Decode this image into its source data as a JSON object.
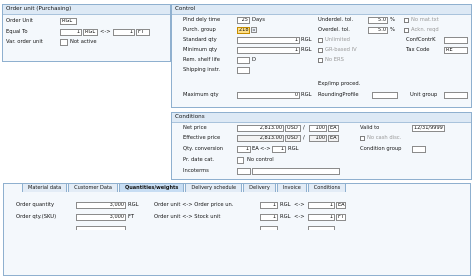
{
  "order_unit_panel": {
    "title": "Order unit (Purchasing)",
    "order_unit_label": "Order Unit",
    "order_unit_value": "RGL",
    "equal_to_label": "Equal To",
    "equal_qty": "1",
    "equal_unit": "RGL",
    "arrow": "<->",
    "equal_qty2": "1",
    "equal_unit2": "FT",
    "var_order_unit_label": "Var. order unit",
    "not_active": "Not active"
  },
  "control": {
    "title": "Control",
    "pind_label": "Plnd dely time",
    "pind_value": "25",
    "pind_unit": "Days",
    "purch_group_label": "Purch. group",
    "purch_group_value": "218",
    "standard_qty_label": "Standard qty",
    "standard_qty_value": "1",
    "standard_qty_unit": "RGL",
    "minimum_qty_label": "Minimum qty",
    "minimum_qty_value": "1",
    "minimum_qty_unit": "RGL",
    "rem_shelf_label": "Rem. shelf life",
    "rem_shelf_unit": "D",
    "shipping_instr_label": "Shipping instr.",
    "maximum_qty_label": "Maximum qty",
    "maximum_qty_value": "0",
    "maximum_qty_unit": "RGL",
    "underdel_label": "Underdel. tol.",
    "underdel_value": "5.0",
    "underdel_pct": "%",
    "overdel_label": "Overdel. tol.",
    "overdel_value": "5.0",
    "overdel_pct": "%",
    "unlimited": "Unlimited",
    "gr_based_iv": "GR-based IV",
    "no_ers": "No ERS",
    "no_mat_txt": "No mat.txt",
    "ackn_reqd": "Ackn. reqd",
    "conf_ctrl_label": "ConfContrK",
    "tax_code_label": "Tax Code",
    "tax_code_value": "RE",
    "exp_imp_label": "Exp/imp proced.",
    "rounding_label": "RoundingProfile",
    "unit_group_label": "Unit group"
  },
  "conditions": {
    "title": "Conditions",
    "net_price_label": "Net price",
    "net_price_value": "2,813.00",
    "net_price_curr": "USD",
    "net_per": "/",
    "net_price_per": "100",
    "net_price_unit": "EA",
    "valid_to_label": "Valid to",
    "valid_to_value": "12/31/9999",
    "effective_price_label": "Effective price",
    "effective_price_value": "2,813.00",
    "effective_price_curr": "USD",
    "eff_per": "/",
    "effective_price_per": "100",
    "effective_price_unit": "EA",
    "no_cash_disc": "No cash disc.",
    "qty_conversion_label": "Qty. conversion",
    "qty_conv_1": "1",
    "qty_conv_unit1": "EA",
    "qty_conv_arrow": "<->",
    "qty_conv_2": "1",
    "qty_conv_unit2": "RGL",
    "condition_group_label": "Condition group",
    "pr_date_cat_label": "Pr. date cat.",
    "no_control": "No control",
    "incoterms_label": "Incoterms"
  },
  "tabs": {
    "items": [
      "Material data",
      "Customer Data",
      "Quantities/weights",
      "Delivery schedule",
      "Delivery",
      "Invoice",
      "Conditions"
    ],
    "active_index": 2
  },
  "quantities": {
    "order_quantity_label": "Order quantity",
    "order_quantity_value": "3,000",
    "order_quantity_unit": "RGL",
    "order_qty_sku_label": "Order qty.(SKU)",
    "order_qty_sku_value": "3,000",
    "order_qty_sku_unit": "FT",
    "conv1_label": "Order unit <-> Order price un.",
    "conv1_a": "1",
    "conv1_a_unit": "RGL",
    "conv1_arrow": "<->",
    "conv1_b": "1",
    "conv1_b_unit": "EA",
    "conv2_label": "Order unit <-> Stock unit",
    "conv2_a": "1",
    "conv2_a_unit": "RGL",
    "conv2_arrow": "<->",
    "conv2_b": "1",
    "conv2_b_unit": "FT"
  }
}
